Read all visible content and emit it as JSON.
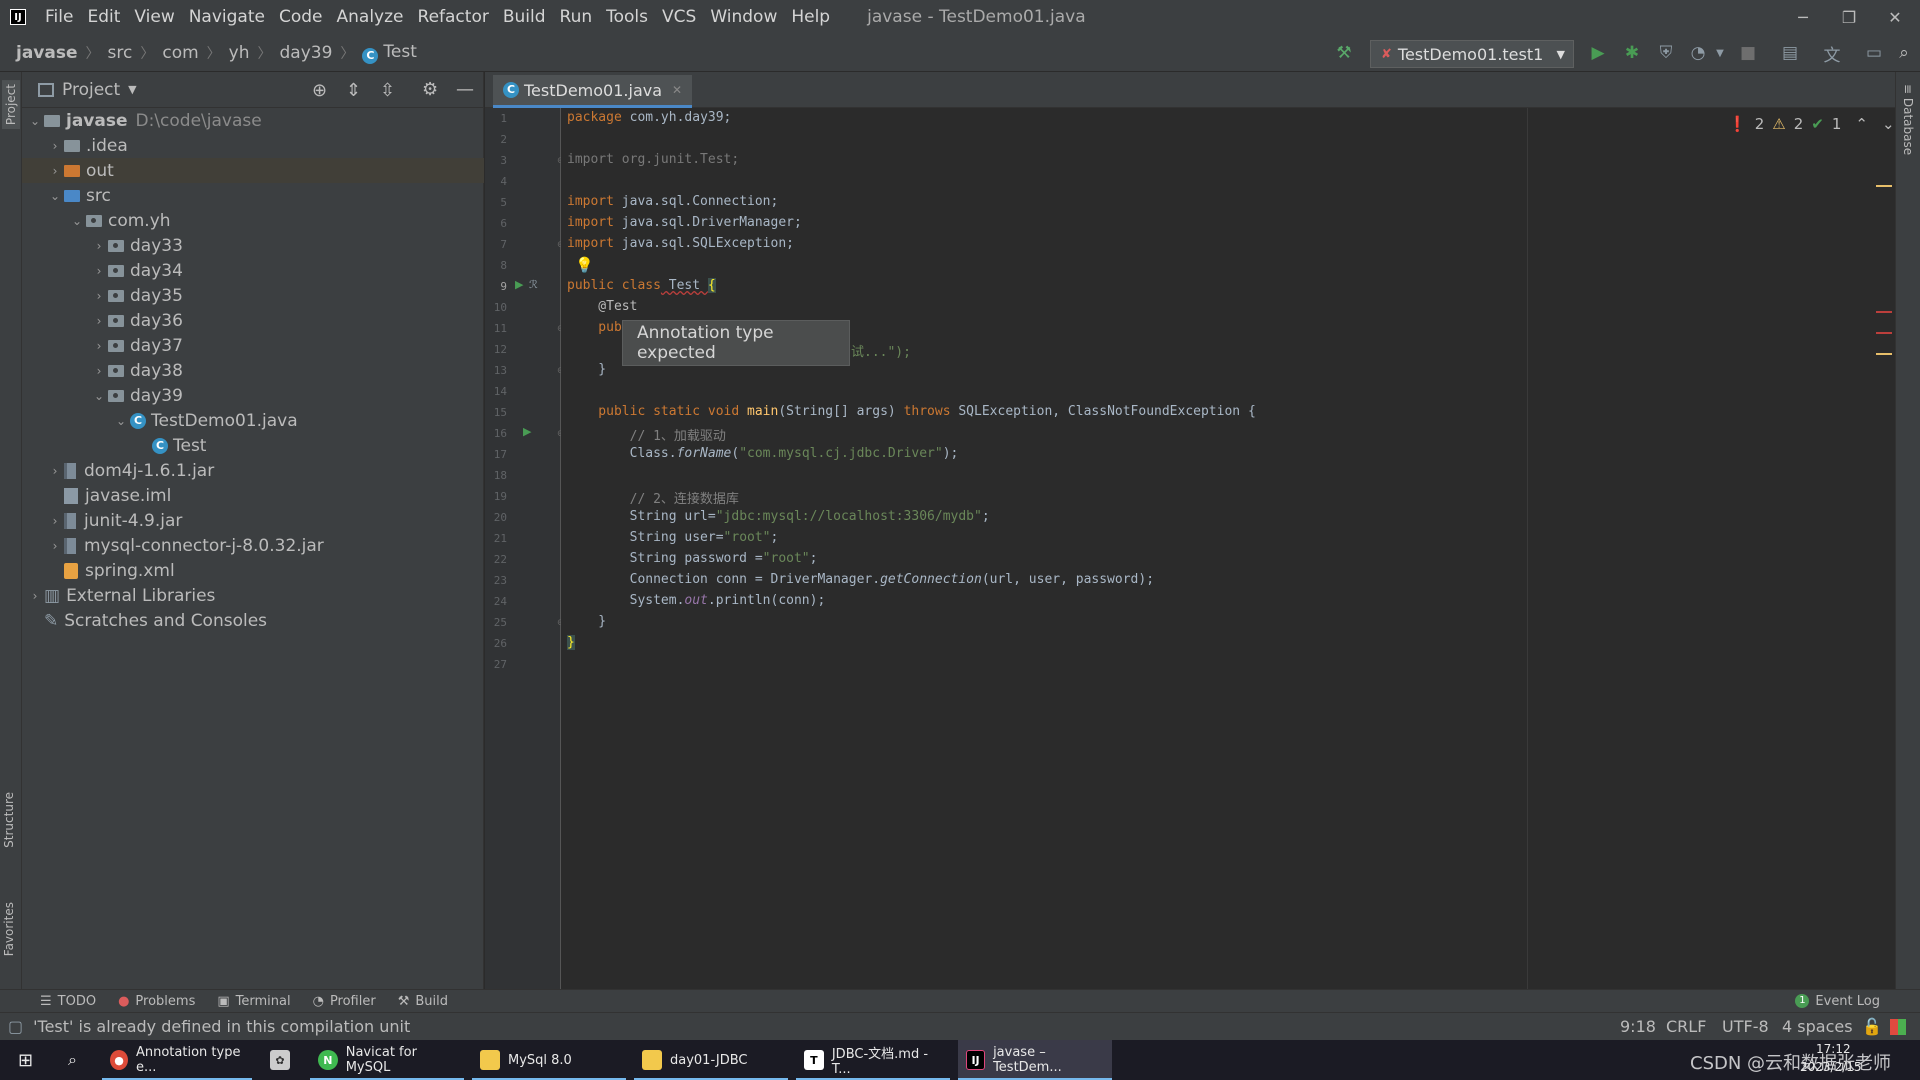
{
  "menubar": {
    "items": [
      "File",
      "Edit",
      "View",
      "Navigate",
      "Code",
      "Analyze",
      "Refactor",
      "Build",
      "Run",
      "Tools",
      "VCS",
      "Window",
      "Help"
    ],
    "window_title": "javase - TestDemo01.java",
    "minimize_icon": "─",
    "restore_icon": "❐",
    "close_icon": "✕"
  },
  "navbar": {
    "crumbs": [
      "javase",
      "src",
      "com",
      "yh",
      "day39",
      "Test"
    ],
    "run_config": "TestDemo01.test1"
  },
  "leftstripe": {
    "project": "Project",
    "structure": "Structure",
    "favorites": "Favorites"
  },
  "rightstripe": {
    "database": "Database"
  },
  "project": {
    "header": "Project",
    "tree": [
      {
        "label": "javase",
        "extra": "D:\\code\\javase"
      },
      {
        "label": ".idea"
      },
      {
        "label": "out"
      },
      {
        "label": "src"
      },
      {
        "label": "com.yh"
      },
      {
        "label": "day33"
      },
      {
        "label": "day34"
      },
      {
        "label": "day35"
      },
      {
        "label": "day36"
      },
      {
        "label": "day37"
      },
      {
        "label": "day38"
      },
      {
        "label": "day39"
      },
      {
        "label": "TestDemo01.java"
      },
      {
        "label": "Test"
      },
      {
        "label": "dom4j-1.6.1.jar"
      },
      {
        "label": "javase.iml"
      },
      {
        "label": "junit-4.9.jar"
      },
      {
        "label": "mysql-connector-j-8.0.32.jar"
      },
      {
        "label": "spring.xml"
      },
      {
        "label": "External Libraries"
      },
      {
        "label": "Scratches and Consoles"
      }
    ]
  },
  "editor": {
    "tab": "TestDemo01.java",
    "line_numbers": [
      "1",
      "2",
      "3",
      "4",
      "5",
      "6",
      "7",
      "8",
      "9",
      "10",
      "11",
      "12",
      "13",
      "14",
      "15",
      "16",
      "17",
      "18",
      "19",
      "20",
      "21",
      "22",
      "23",
      "24",
      "25",
      "26",
      "27"
    ],
    "code": {
      "l1a": "package",
      "l1b": " com.yh.day39;",
      "l3": "import org.junit.Test;",
      "l5a": "import",
      "l5b": " java.sql.Connection;",
      "l6a": "import",
      "l6b": " java.sql.DriverManager;",
      "l7a": "import",
      "l7b": " java.sql.SQLException;",
      "l9a": "public class",
      "l9b": " Test ",
      "l9c": "{",
      "l10": "    @Test",
      "l11": "    pub",
      "l12": "试...\");",
      "l13": "    }",
      "l15a": "    public static void ",
      "l15b": "main",
      "l15c": "(String[] args) ",
      "l15d": "throws",
      "l15e": " SQLException, ClassNotFoundException {",
      "l16": "        // 1、加载驱动",
      "l17a": "        Class.",
      "l17b": "forName",
      "l17c": "(",
      "l17d": "\"com.mysql.cj.jdbc.Driver\"",
      "l17e": ");",
      "l19": "        // 2、连接数据库",
      "l20a": "        String url=",
      "l20b": "\"jdbc:mysql://localhost:3306/mydb\"",
      "l20c": ";",
      "l21a": "        String user=",
      "l21b": "\"root\"",
      "l21c": ";",
      "l22a": "        String password =",
      "l22b": "\"root\"",
      "l22c": ";",
      "l23a": "        Connection conn = DriverManager.",
      "l23b": "getConnection",
      "l23c": "(url, user, password);",
      "l24a": "        System.",
      "l24b": "out",
      "l24c": ".println(conn);",
      "l25": "    }",
      "l26": "}"
    },
    "tooltip": "Annotation type expected",
    "inspection": {
      "errors": "2",
      "warnings": "2",
      "ok": "1"
    }
  },
  "bottom_tools": [
    "TODO",
    "Problems",
    "Terminal",
    "Profiler",
    "Build"
  ],
  "event_log": "Event Log",
  "status": {
    "message": "'Test' is already defined in this compilation unit",
    "position": "9:18",
    "line_sep": "CRLF",
    "encoding": "UTF-8",
    "indent": "4 spaces"
  },
  "taskbar": {
    "items": [
      "Annotation type e...",
      "Navicat for MySQL",
      "MySql 8.0",
      "day01-JDBC",
      "JDBC-文档.md - T...",
      "javase – TestDem..."
    ],
    "watermark": "CSDN @云和数据张老师",
    "time": "17:12",
    "date": "2023/2/15"
  },
  "colors": {
    "accent": "#4a88c7",
    "error": "#db5c5c",
    "warning": "#e8bf6a",
    "ok": "#499c54",
    "keyword": "#cc7832",
    "string": "#6a8759"
  }
}
